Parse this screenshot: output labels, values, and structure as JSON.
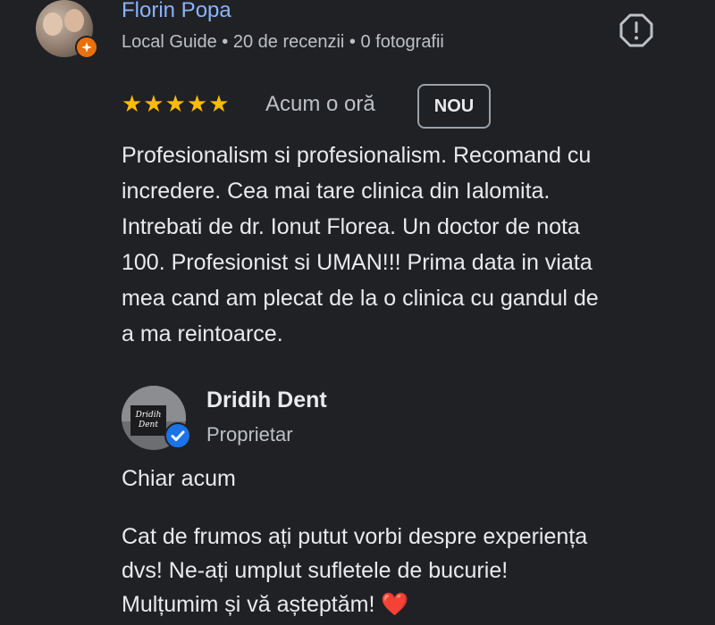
{
  "review": {
    "author_name": "Florin Popa",
    "author_meta": "Local Guide • 20 de recenzii • 0 fotografii",
    "stars": "★★★★★",
    "rating": 5,
    "time": "Acum o oră",
    "badge": "NOU",
    "text_lines": [
      "Profesionalism si profesionalism. Recomand cu",
      "incredere. Cea mai tare clinica din Ialomita.",
      "Intrebati de dr. Ionut Florea. Un doctor de nota",
      "100. Profesionist si UMAN!!! Prima data in viata",
      "mea cand am plecat de la o clinica cu gandul de",
      "a ma reintoarce."
    ]
  },
  "owner_reply": {
    "owner_name": "Dridih Dent",
    "owner_role": "Proprietar",
    "avatar_sign_text": "Dridih Dent",
    "time": "Chiar acum",
    "text_lines": [
      "Cat de frumos ați putut vorbi despre experiența",
      "dvs! Ne-ați umplut sufletele de bucurie!",
      "Mulțumim și vă așteptăm!"
    ],
    "emoji": "❤️"
  },
  "colors": {
    "background": "#202124",
    "link_blue": "#8ab4f8",
    "star_yellow": "#fbbc04",
    "guide_orange": "#e8710a",
    "verified_blue": "#1a73e8"
  }
}
